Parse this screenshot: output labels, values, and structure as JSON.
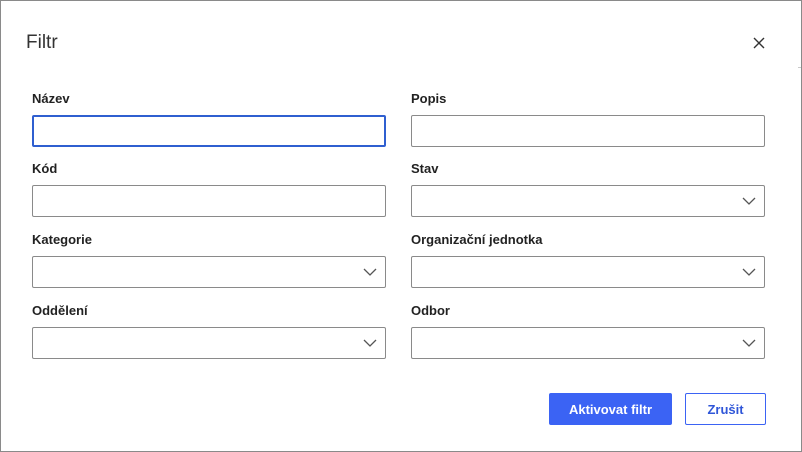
{
  "dialog": {
    "title": "Filtr",
    "close_icon": "close-icon"
  },
  "fields": {
    "nazev": {
      "label": "Název",
      "value": ""
    },
    "popis": {
      "label": "Popis",
      "value": ""
    },
    "kod": {
      "label": "Kód",
      "value": ""
    },
    "stav": {
      "label": "Stav",
      "value": ""
    },
    "kategorie": {
      "label": "Kategorie",
      "value": ""
    },
    "organizacni_jednotka": {
      "label": "Organizační jednotka",
      "value": ""
    },
    "oddeleni": {
      "label": "Oddělení",
      "value": ""
    },
    "odbor": {
      "label": "Odbor",
      "value": ""
    }
  },
  "buttons": {
    "apply_label": "Aktivovat filtr",
    "cancel_label": "Zrušit"
  },
  "colors": {
    "primary": "#3b63f4",
    "focus_border": "#2f5fd0",
    "input_border": "#8a8a8a"
  }
}
